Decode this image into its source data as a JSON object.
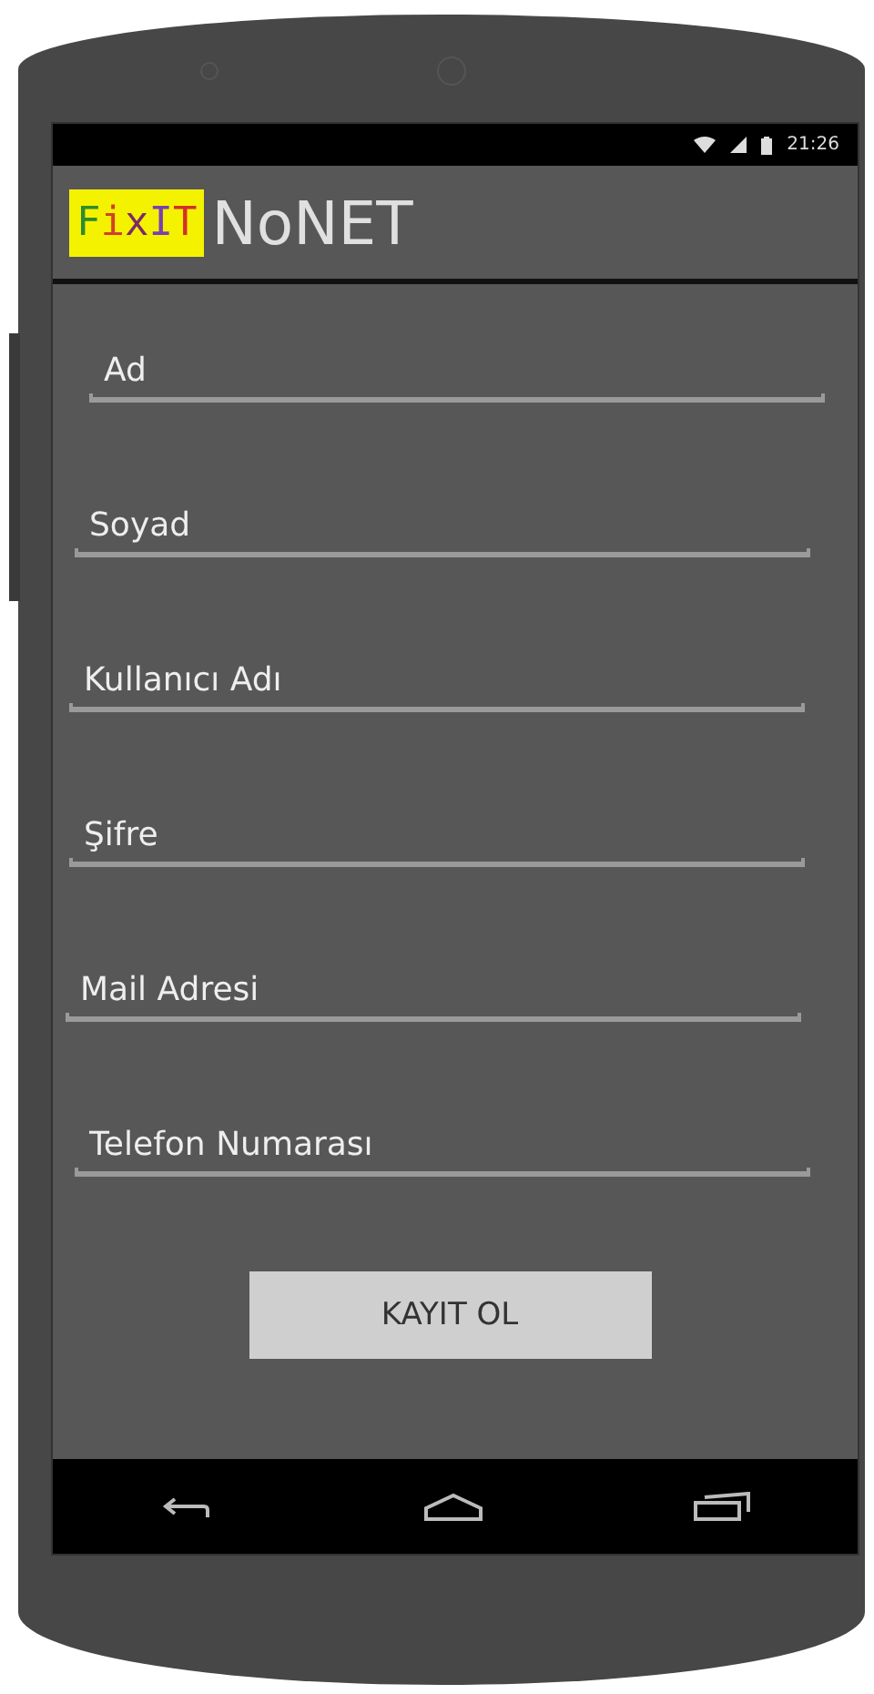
{
  "status_bar": {
    "time": "21:26"
  },
  "app_bar": {
    "logo": {
      "text": "FixIT"
    },
    "title": "NoNET"
  },
  "fields": [
    {
      "placeholder": "Ad"
    },
    {
      "placeholder": "Soyad"
    },
    {
      "placeholder": "Kullanıcı Adı"
    },
    {
      "placeholder": "Şifre"
    },
    {
      "placeholder": "Mail Adresi"
    },
    {
      "placeholder": "Telefon Numarası"
    }
  ],
  "button": {
    "label": "KAYIT OL"
  }
}
